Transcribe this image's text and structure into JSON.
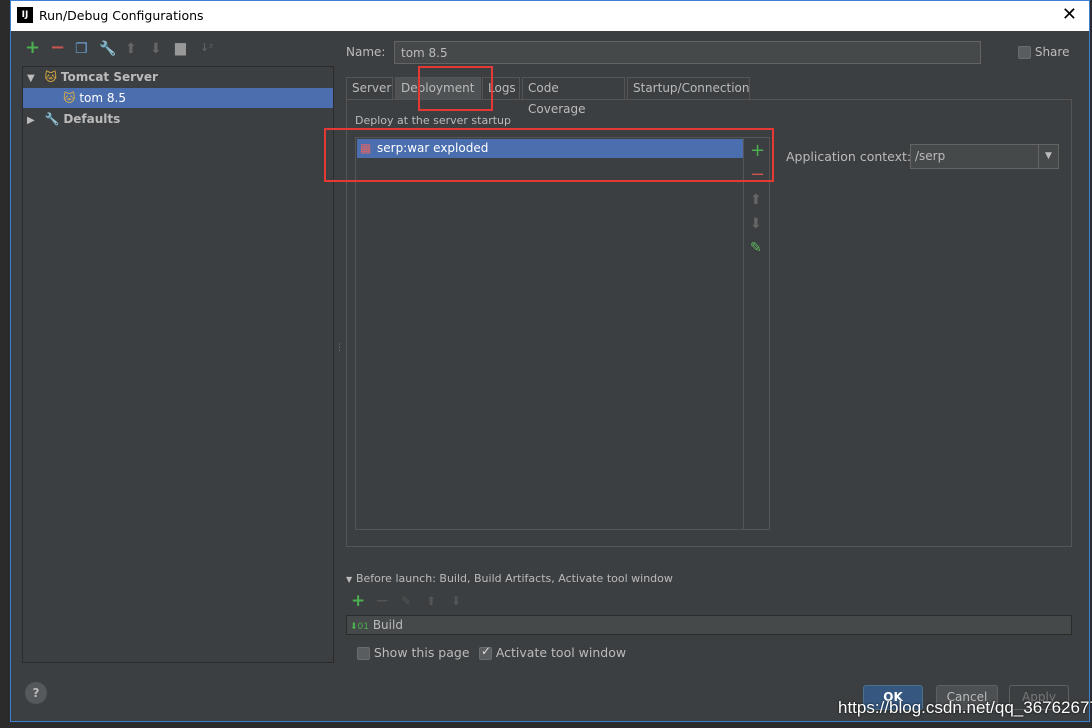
{
  "window": {
    "title": "Run/Debug Configurations",
    "logo": "IJ"
  },
  "left": {
    "toolbar": [
      "add-icon",
      "remove-icon",
      "copy-icon",
      "wrench-icon",
      "move-up-icon",
      "move-down-icon",
      "folder-icon",
      "sort-icon"
    ],
    "tree": [
      {
        "label": "Tomcat Server"
      },
      {
        "label": "tom 8.5"
      },
      {
        "label": "Defaults"
      }
    ]
  },
  "name": {
    "label": "Name:",
    "value": "tom 8.5"
  },
  "share": {
    "label": "Share",
    "checked": false
  },
  "tabs": [
    {
      "label": "Server"
    },
    {
      "label": "Deployment",
      "active": true
    },
    {
      "label": "Logs"
    },
    {
      "label": "Code Coverage"
    },
    {
      "label": "Startup/Connection"
    }
  ],
  "deployment": {
    "section": "Deploy at the server startup",
    "items": [
      "serp:war exploded"
    ],
    "app_context_label": "Application context:",
    "app_context_value": "/serp"
  },
  "before_launch": {
    "title": "Before launch: Build, Build Artifacts, Activate tool window",
    "items": [
      "Build"
    ],
    "show_page": {
      "label": "Show this page",
      "checked": false
    },
    "activate": {
      "label": "Activate tool window",
      "checked": true
    }
  },
  "buttons": {
    "ok": "OK",
    "cancel": "Cancel",
    "apply": "Apply",
    "help": "?"
  },
  "watermark": "https://blog.csdn.net/qq_36762677",
  "colors": {
    "highlight": "#e53935",
    "selection": "#4b6eaf",
    "add": "#4caf50"
  }
}
